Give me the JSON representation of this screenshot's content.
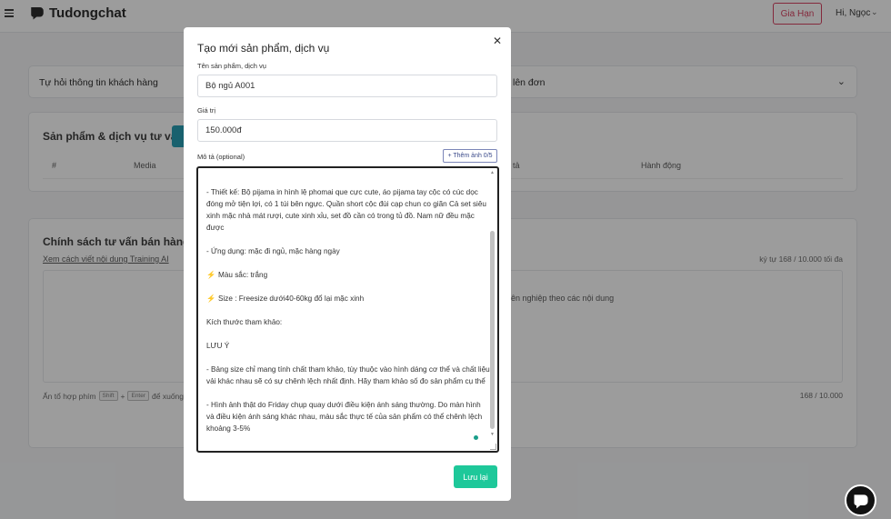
{
  "app": {
    "brand": "Tudongchat"
  },
  "topbar": {
    "plan_button": "Gia Hạn",
    "greeting": "Hi, Ngọc"
  },
  "background": {
    "auto_ask": {
      "title": "Tự hỏi thông tin khách hàng",
      "title_right": "lên đơn"
    },
    "products": {
      "title": "Sản phẩm & dịch vụ tư vấn",
      "columns": [
        "#",
        "Media",
        "tả",
        "Hành động"
      ]
    },
    "policy": {
      "title": "Chính sách tư vấn bán hàng",
      "link": "Xem cách viết nội dung Training AI",
      "count_top": "ký tự 168 / 10.000 tối đa",
      "area_text": "ên nghiệp theo các nội dung",
      "hint_prefix": "Ấn tổ hợp phím",
      "hint_key1": "Shift",
      "hint_plus": "+",
      "hint_key2": "Enter",
      "hint_suffix": "để xuống",
      "count_bottom": "168 / 10.000"
    }
  },
  "modal": {
    "title": "Tạo mới sản phẩm, dịch vụ",
    "name_label": "Tên sản phẩm, dịch vụ",
    "name_value": "Bộ ngủ A001",
    "price_label": "Giá trị",
    "price_value": "150.000đ",
    "desc_label": "Mô tả (optional)",
    "add_image_button": "+ Thêm ảnh 0/5",
    "desc_lines": [
      "- Thiết kế: Bộ pijama in hình lệ phomai que  cực cute, áo pijama tay cộc có cúc dọc đóng mở tiện lợi, có 1 túi bên ngực. Quần short cộc đùi cạp chun co giãn Cả set siêu xinh mặc nhà mát rượi, cute xinh xỉu, set đồ cần có trong tủ đồ. Nam nữ đều mặc được",
      "",
      "- Ứng dụng: mặc đi ngủ, mặc hàng ngày",
      "",
      "Màu sắc: trắng",
      "",
      "Size :  Freesize dưới40-60kg đổ lại mặc xinh",
      "",
      "Kích thước tham khảo:",
      "",
      "LƯU Ý",
      "",
      "-  Bảng size chỉ mang tính chất tham khảo, tùy thuộc vào hình dáng cơ thể và chất liệu vải khác nhau sẽ có sự chênh lệch nhất định. Hãy tham khảo số đo sản phẩm cụ thể",
      "",
      "- Hình ảnh thật do Friday chụp quay dưới điều kiện ánh sáng thường. Do màn hình và điều kiện ánh sáng khác nhau, màu sắc thực tế của sản phẩm có thể chênh lệch khoảng 3-5%"
    ],
    "save_button": "Lưu lại"
  }
}
